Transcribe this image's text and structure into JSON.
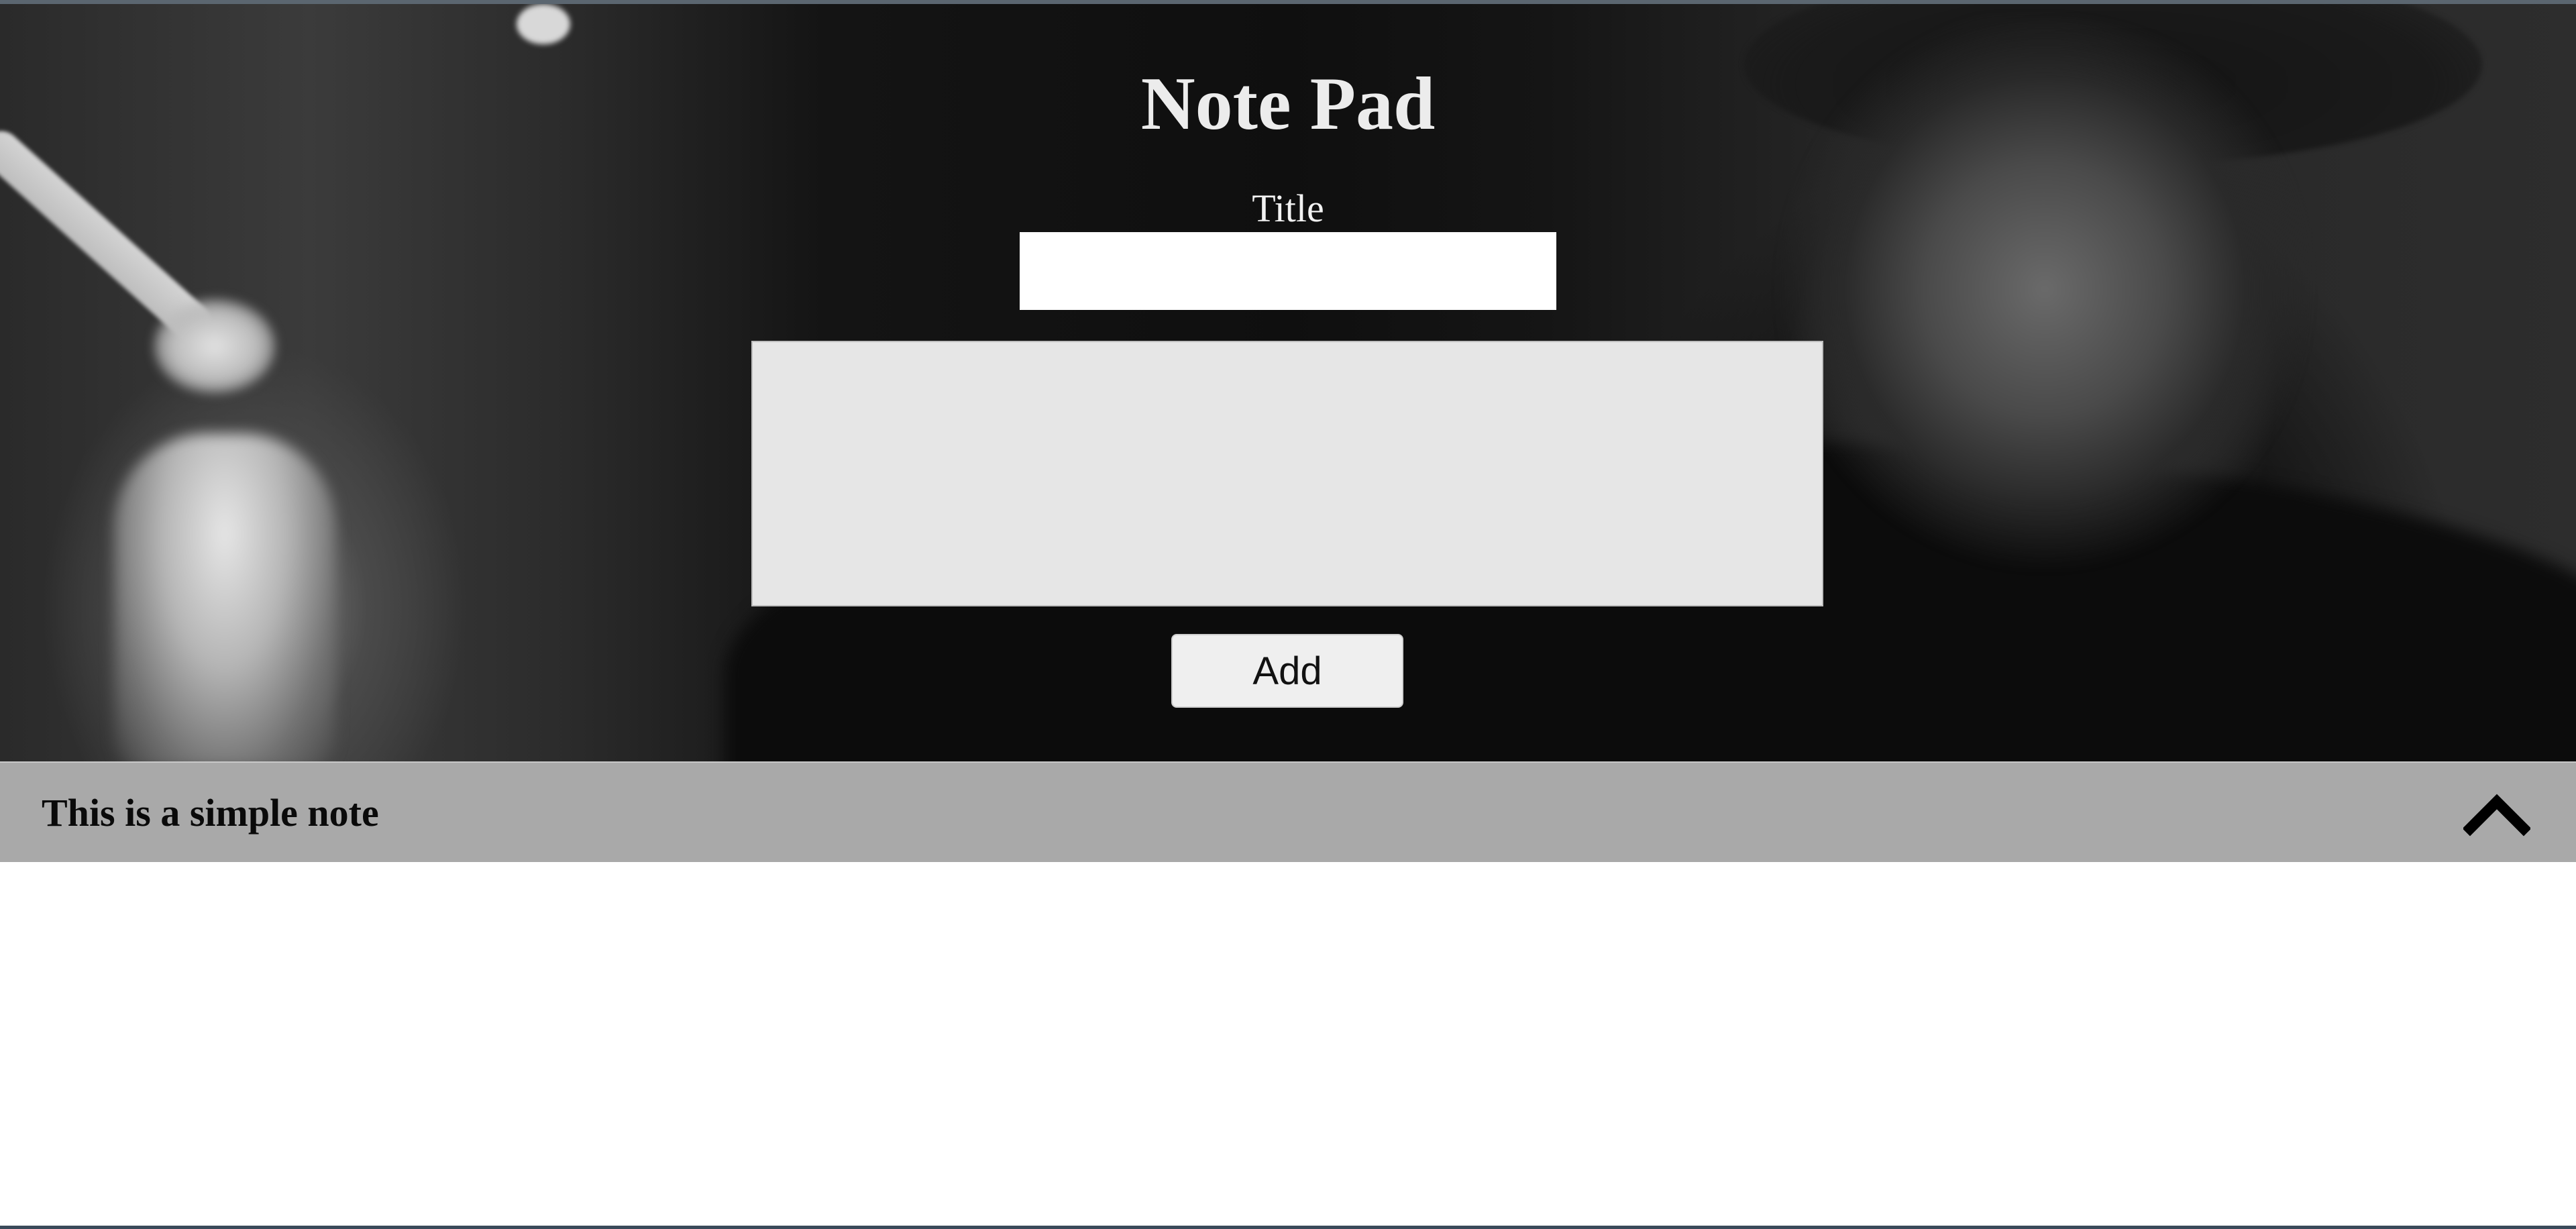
{
  "app": {
    "title": "Note Pad"
  },
  "form": {
    "title_label": "Title",
    "title_value": "",
    "body_value": "",
    "add_button_label": "Add"
  },
  "notes": [
    {
      "title": "This is a simple note",
      "toggle_icon": "chevron-up-icon",
      "expanded": true,
      "body": ""
    }
  ]
}
